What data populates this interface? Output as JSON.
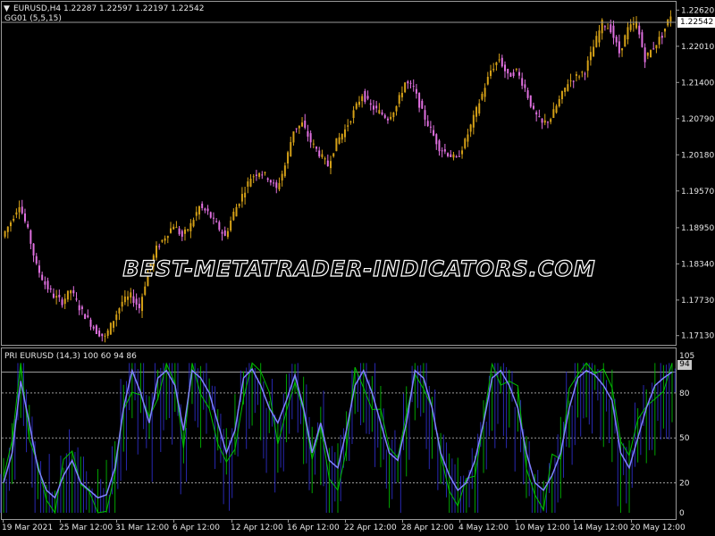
{
  "header": {
    "symbol_line": "EURUSD,H4  1.22287 1.22597 1.22197 1.22542",
    "indicator_top": "GG01 (5,5,15)",
    "indicator_bottom": "PRI EURUSD (14,3) 100 60 94 86"
  },
  "price_tags": {
    "current_price": "1.22542",
    "current_indicator": "94"
  },
  "watermark": "BEST-METATRADER-INDICATORS.COM",
  "colors": {
    "background": "#000000",
    "bull_candle": "#d4a017",
    "bear_candle": "#e070e0",
    "grid": "#9a9a9a",
    "osc_main": "#8080ff",
    "osc_green": "#00c000",
    "osc_bar_blue": "#3030d0"
  },
  "chart_data": [
    {
      "type": "line",
      "title": "",
      "xlabel": "",
      "ylabel": "",
      "series": [
        {
          "values": [
            1.188,
            1.1905,
            1.1935,
            1.189,
            1.183,
            1.18,
            1.178,
            1.177,
            1.179,
            1.176,
            1.174,
            1.172,
            1.171,
            1.174,
            1.177,
            1.178,
            1.176,
            1.182,
            1.186,
            1.188,
            1.19,
            1.188,
            1.19,
            1.193,
            1.192,
            1.19,
            1.188,
            1.192,
            1.195,
            1.198,
            1.199,
            1.198,
            1.196,
            1.2,
            1.206,
            1.207,
            1.204,
            1.202,
            1.2,
            1.204,
            1.206,
            1.209,
            1.212,
            1.21,
            1.209,
            1.208,
            1.21,
            1.214,
            1.213,
            1.209,
            1.206,
            1.203,
            1.202,
            1.201,
            1.204,
            1.208,
            1.212,
            1.216,
            1.218,
            1.215,
            1.216,
            1.213,
            1.209,
            1.207,
            1.208,
            1.211,
            1.214,
            1.215,
            1.216,
            1.22,
            1.224,
            1.223,
            1.219,
            1.223,
            1.224,
            1.218,
            1.22,
            1.222,
            1.2254
          ]
        }
      ],
      "x_tick_labels": [
        "19 Mar 2021",
        "25 Mar 12:00",
        "31 Mar 12:00",
        "6 Apr 12:00",
        "12 Apr 12:00",
        "16 Apr 12:00",
        "22 Apr 12:00",
        "28 Apr 12:00",
        "4 May 12:00",
        "10 May 12:00",
        "14 May 12:00",
        "20 May 12:00"
      ],
      "y_ticks": [
        1.1713,
        1.1773,
        1.1834,
        1.1895,
        1.1957,
        1.2018,
        1.2079,
        1.214,
        1.2201,
        1.2262
      ],
      "y_tick_labels": [
        "1.17130",
        "1.17730",
        "1.18340",
        "1.18950",
        "1.19570",
        "1.20180",
        "1.20790",
        "1.21400",
        "1.22010",
        "1.22620"
      ],
      "ylim": [
        1.1699,
        1.227
      ],
      "grid": false
    },
    {
      "type": "line",
      "title": "",
      "series": [
        {
          "values": [
            20,
            40,
            88,
            60,
            30,
            15,
            10,
            25,
            35,
            20,
            15,
            10,
            12,
            30,
            70,
            95,
            80,
            60,
            90,
            95,
            85,
            55,
            95,
            90,
            80,
            60,
            40,
            55,
            90,
            96,
            85,
            70,
            60,
            75,
            92,
            70,
            40,
            60,
            35,
            30,
            55,
            85,
            95,
            80,
            60,
            40,
            35,
            60,
            95,
            90,
            70,
            40,
            25,
            15,
            20,
            35,
            60,
            90,
            95,
            85,
            70,
            40,
            20,
            15,
            25,
            40,
            70,
            90,
            95,
            92,
            85,
            75,
            40,
            30,
            50,
            70,
            85,
            90,
            94
          ]
        }
      ],
      "ylim": [
        0,
        105
      ],
      "y_ticks": [
        105,
        94,
        80,
        50,
        20,
        0
      ],
      "y_tick_labels": [
        "105",
        "94",
        "80",
        "50",
        "20",
        "0"
      ],
      "reference_lines": [
        80,
        50,
        20
      ]
    }
  ]
}
